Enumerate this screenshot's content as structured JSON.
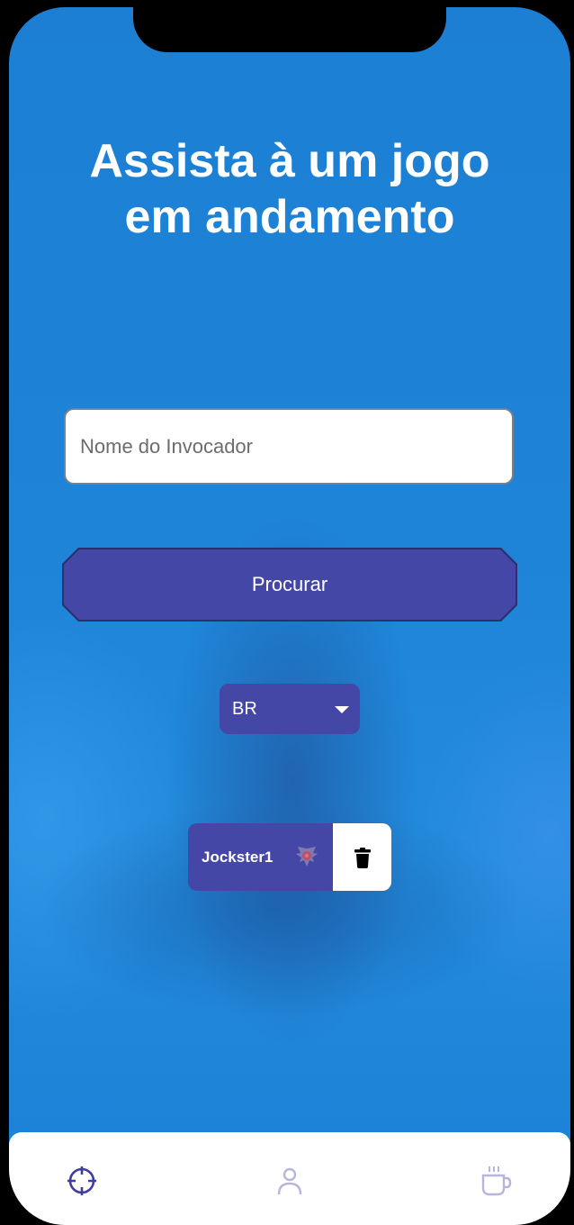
{
  "header": {
    "title_line1": "Assista à um jogo",
    "title_line2": "em andamento"
  },
  "search": {
    "placeholder": "Nome do Invocador",
    "value": "",
    "button_label": "Procurar"
  },
  "region": {
    "selected": "BR"
  },
  "recent": {
    "items": [
      {
        "name": "Jockster1",
        "emblem_icon": "rank-emblem-icon",
        "delete_icon": "trash-icon"
      }
    ]
  },
  "tabbar": {
    "tabs": [
      {
        "icon": "crosshair-icon",
        "active": true
      },
      {
        "icon": "user-icon",
        "active": false
      },
      {
        "icon": "coffee-cup-icon",
        "active": false
      }
    ]
  },
  "colors": {
    "background": "#1e84d8",
    "accent": "#4447a6",
    "active_tab": "#3f3d9e",
    "inactive_tab": "#b7b5da"
  }
}
